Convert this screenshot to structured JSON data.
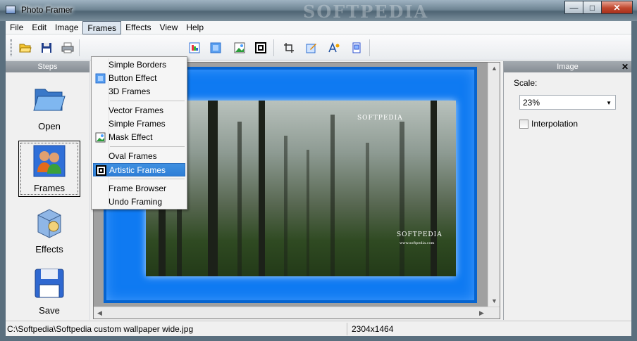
{
  "window": {
    "title": "Photo Framer",
    "watermark": "SOFTPEDIA",
    "minimize_glyph": "—",
    "maximize_glyph": "□",
    "close_glyph": "✕"
  },
  "menubar": [
    "File",
    "Edit",
    "Image",
    "Frames",
    "Effects",
    "View",
    "Help"
  ],
  "toolbar": {
    "icons": [
      "open-folder-icon",
      "save-icon",
      "print-icon",
      "simple-borders-icon",
      "button-effect-icon",
      "mask-effect-icon",
      "artistic-frames-icon",
      "crop-icon",
      "adjust-image-icon",
      "text-icon",
      "frame-browser-icon"
    ]
  },
  "steps": {
    "title": "Steps",
    "items": [
      "Open",
      "Frames",
      "Effects",
      "Save"
    ],
    "selected": "Frames"
  },
  "frames_menu": {
    "items": [
      {
        "label": "Simple Borders"
      },
      {
        "label": "Button Effect",
        "icon": "button-effect-icon"
      },
      {
        "label": "3D Frames"
      },
      {
        "label": "Vector Frames"
      },
      {
        "label": "Simple Frames"
      },
      {
        "label": "Mask Effect",
        "icon": "mask-effect-icon"
      },
      {
        "label": "Oval Frames"
      },
      {
        "label": "Artistic Frames",
        "icon": "artistic-frames-icon",
        "highlighted": true
      },
      {
        "label": "Frame Browser"
      },
      {
        "label": "Undo Framing"
      }
    ]
  },
  "image_panel": {
    "title": "Image",
    "close_glyph": "✕",
    "scale_label": "Scale:",
    "scale_value": "23%",
    "interpolation_label": "Interpolation",
    "interpolation_checked": false
  },
  "photo": {
    "watermark_top": "SOFTPEDIA",
    "watermark_bottom": "SOFTPEDIA",
    "watermark_url": "www.softpedia.com"
  },
  "statusbar": {
    "path": "C:\\Softpedia\\Softpedia custom wallpaper wide.jpg",
    "dimensions": "2304x1464"
  },
  "colors": {
    "frame_blue": "#0f7af2",
    "menu_highlight": "#3e8fe0"
  }
}
